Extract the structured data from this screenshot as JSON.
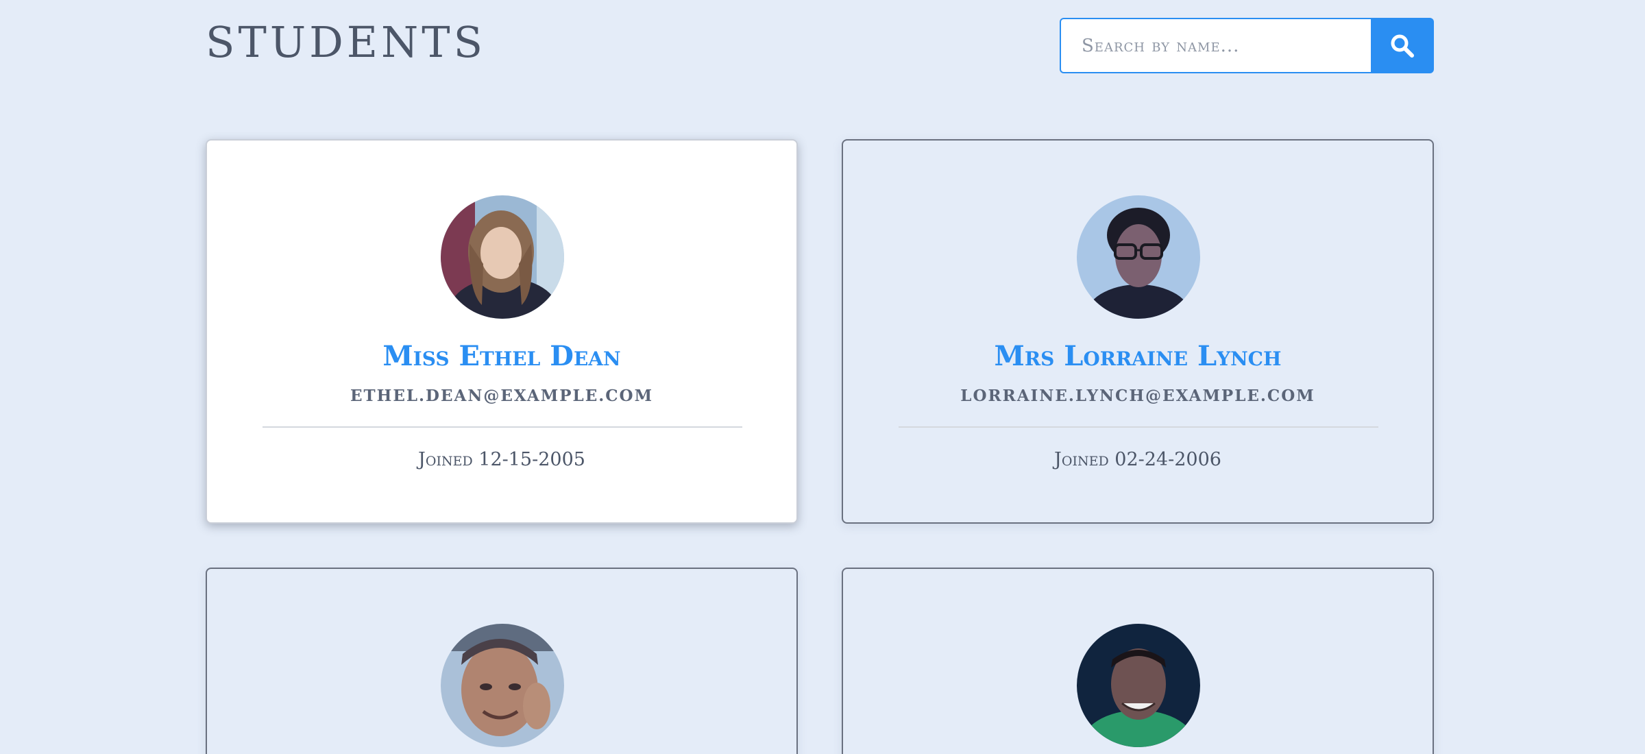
{
  "header": {
    "title": "STUDENTS"
  },
  "search": {
    "placeholder": "Search by name...",
    "value": "",
    "button_icon": "search-icon"
  },
  "colors": {
    "accent": "#2a8ef2",
    "background": "#e4ecf8",
    "text": "#4c5668"
  },
  "students": [
    {
      "name": "Miss Ethel Dean",
      "email": "ethel.dean@example.com",
      "joined": "Joined 12-15-2005",
      "active": true
    },
    {
      "name": "Mrs Lorraine Lynch",
      "email": "lorraine.lynch@example.com",
      "joined": "Joined 02-24-2006",
      "active": false
    },
    {
      "name": "",
      "email": "",
      "joined": "",
      "active": false
    },
    {
      "name": "",
      "email": "",
      "joined": "",
      "active": false
    }
  ]
}
